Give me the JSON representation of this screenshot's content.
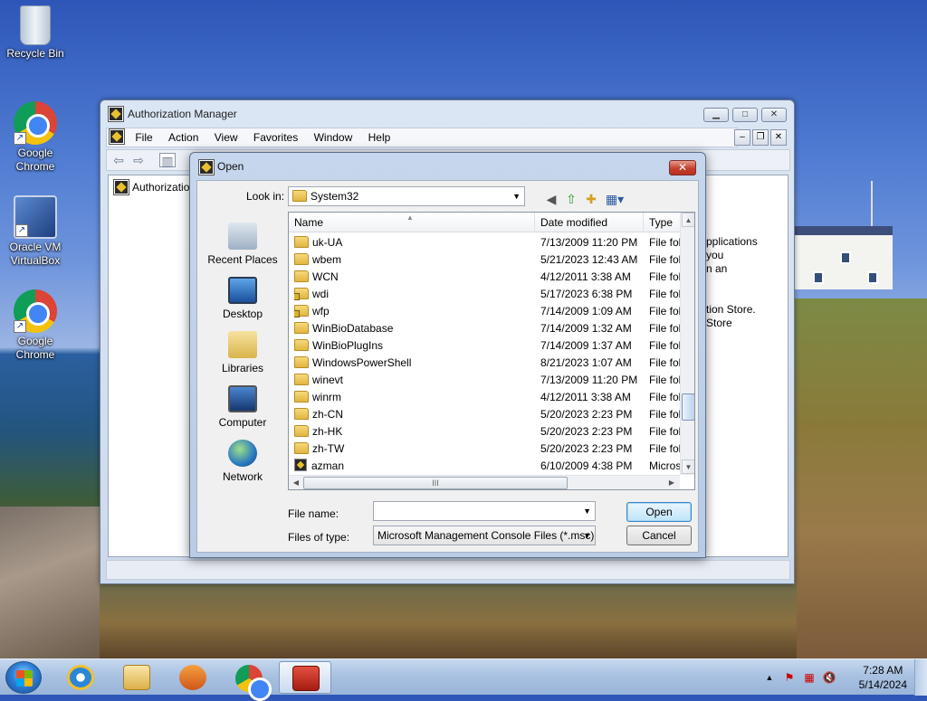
{
  "desktop": {
    "icons": [
      {
        "label": "Recycle Bin",
        "icon": "recycle-bin-icon"
      },
      {
        "label": "Google Chrome",
        "icon": "chrome-icon"
      },
      {
        "label": "Oracle VM VirtualBox",
        "icon": "virtualbox-icon"
      },
      {
        "label": "Google Chrome",
        "icon": "chrome-icon"
      }
    ]
  },
  "main_window": {
    "title": "Authorization Manager",
    "menu": [
      "File",
      "Action",
      "View",
      "Favorites",
      "Window",
      "Help"
    ],
    "tree_root": "Authorization",
    "right_pane_text": [
      "pplications",
      "you",
      "n an",
      "",
      "",
      "tion Store.",
      "Store"
    ]
  },
  "dialog": {
    "title": "Open",
    "look_in_label": "Look in:",
    "look_in_value": "System32",
    "places": [
      "Recent Places",
      "Desktop",
      "Libraries",
      "Computer",
      "Network"
    ],
    "columns": {
      "name": "Name",
      "date": "Date modified",
      "type": "Type"
    },
    "files": [
      {
        "name": "uk-UA",
        "date": "7/13/2009 11:20 PM",
        "type": "File fol",
        "kind": "folder"
      },
      {
        "name": "wbem",
        "date": "5/21/2023 12:43 AM",
        "type": "File fol",
        "kind": "folder"
      },
      {
        "name": "WCN",
        "date": "4/12/2011 3:38 AM",
        "type": "File fol",
        "kind": "folder"
      },
      {
        "name": "wdi",
        "date": "5/17/2023 6:38 PM",
        "type": "File fol",
        "kind": "locked-folder"
      },
      {
        "name": "wfp",
        "date": "7/14/2009 1:09 AM",
        "type": "File fol",
        "kind": "locked-folder"
      },
      {
        "name": "WinBioDatabase",
        "date": "7/14/2009 1:32 AM",
        "type": "File fol",
        "kind": "folder"
      },
      {
        "name": "WinBioPlugIns",
        "date": "7/14/2009 1:37 AM",
        "type": "File fol",
        "kind": "folder"
      },
      {
        "name": "WindowsPowerShell",
        "date": "8/21/2023 1:07 AM",
        "type": "File fol",
        "kind": "folder"
      },
      {
        "name": "winevt",
        "date": "7/13/2009 11:20 PM",
        "type": "File fol",
        "kind": "folder"
      },
      {
        "name": "winrm",
        "date": "4/12/2011 3:38 AM",
        "type": "File fol",
        "kind": "folder"
      },
      {
        "name": "zh-CN",
        "date": "5/20/2023 2:23 PM",
        "type": "File fol",
        "kind": "folder"
      },
      {
        "name": "zh-HK",
        "date": "5/20/2023 2:23 PM",
        "type": "File fol",
        "kind": "folder"
      },
      {
        "name": "zh-TW",
        "date": "5/20/2023 2:23 PM",
        "type": "File fol",
        "kind": "folder"
      },
      {
        "name": "azman",
        "date": "6/10/2009 4:38 PM",
        "type": "Micros",
        "kind": "msc"
      }
    ],
    "file_name_label": "File name:",
    "file_name_value": "",
    "file_type_label": "Files of type:",
    "file_type_value": "Microsoft Management Console Files (*.msc)",
    "open_button": "Open",
    "cancel_button": "Cancel",
    "hscroll_grip": "III"
  },
  "taskbar": {
    "items": [
      "internet-explorer-icon",
      "file-explorer-icon",
      "media-player-icon",
      "chrome-icon",
      "toolbox-icon"
    ],
    "time": "7:28 AM",
    "date": "5/14/2024"
  }
}
